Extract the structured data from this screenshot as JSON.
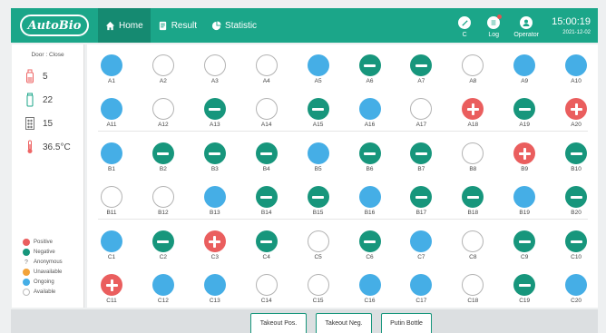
{
  "header": {
    "logo": "AutoBio",
    "nav": [
      {
        "label": "Home",
        "icon": "home-icon",
        "active": true
      },
      {
        "label": "Result",
        "icon": "result-icon",
        "active": false
      },
      {
        "label": "Statistic",
        "icon": "pie-chart-icon",
        "active": false
      }
    ],
    "status_icons": [
      {
        "label": "C",
        "icon": "compass-icon"
      },
      {
        "label": "Log",
        "icon": "log-icon"
      },
      {
        "label": "Operator",
        "icon": "user-icon"
      }
    ],
    "time": "15:00:19",
    "date": "2021-12-02"
  },
  "sidebar": {
    "door_status": "Door : Close",
    "stats": [
      {
        "icon": "bottle-icon",
        "value": "5"
      },
      {
        "icon": "tube-icon",
        "value": "22"
      },
      {
        "icon": "rack-icon",
        "value": "15"
      },
      {
        "icon": "thermometer-icon",
        "value": "36.5°C"
      }
    ],
    "legend": [
      {
        "label": "Positive",
        "state": "positive"
      },
      {
        "label": "Negative",
        "state": "negative"
      },
      {
        "label": "Anonymous",
        "state": "anonymous"
      },
      {
        "label": "Unavailable",
        "state": "unavailable"
      },
      {
        "label": "Ongoing",
        "state": "ongoing"
      },
      {
        "label": "Available",
        "state": "available"
      }
    ]
  },
  "grid": {
    "sections": [
      {
        "rows": [
          [
            [
              "A1",
              "ongoing"
            ],
            [
              "A2",
              "available"
            ],
            [
              "A3",
              "available"
            ],
            [
              "A4",
              "available"
            ],
            [
              "A5",
              "ongoing"
            ],
            [
              "A6",
              "negative"
            ],
            [
              "A7",
              "negative"
            ],
            [
              "A8",
              "available"
            ],
            [
              "A9",
              "ongoing"
            ],
            [
              "A10",
              "ongoing"
            ]
          ],
          [
            [
              "A11",
              "ongoing"
            ],
            [
              "A12",
              "available"
            ],
            [
              "A13",
              "negative"
            ],
            [
              "A14",
              "available"
            ],
            [
              "A15",
              "negative"
            ],
            [
              "A16",
              "ongoing"
            ],
            [
              "A17",
              "available"
            ],
            [
              "A18",
              "positive"
            ],
            [
              "A19",
              "negative"
            ],
            [
              "A20",
              "positive"
            ]
          ]
        ]
      },
      {
        "rows": [
          [
            [
              "B1",
              "ongoing"
            ],
            [
              "B2",
              "negative"
            ],
            [
              "B3",
              "negative"
            ],
            [
              "B4",
              "negative"
            ],
            [
              "B5",
              "ongoing"
            ],
            [
              "B6",
              "negative"
            ],
            [
              "B7",
              "negative"
            ],
            [
              "B8",
              "available"
            ],
            [
              "B9",
              "positive"
            ],
            [
              "B10",
              "negative"
            ]
          ],
          [
            [
              "B11",
              "available"
            ],
            [
              "B12",
              "available"
            ],
            [
              "B13",
              "ongoing"
            ],
            [
              "B14",
              "negative"
            ],
            [
              "B15",
              "negative"
            ],
            [
              "B16",
              "ongoing"
            ],
            [
              "B17",
              "negative"
            ],
            [
              "B18",
              "negative"
            ],
            [
              "B19",
              "ongoing"
            ],
            [
              "B20",
              "negative"
            ]
          ]
        ]
      },
      {
        "rows": [
          [
            [
              "C1",
              "ongoing"
            ],
            [
              "C2",
              "negative"
            ],
            [
              "C3",
              "positive"
            ],
            [
              "C4",
              "negative"
            ],
            [
              "C5",
              "available"
            ],
            [
              "C6",
              "negative"
            ],
            [
              "C7",
              "ongoing"
            ],
            [
              "C8",
              "available"
            ],
            [
              "C9",
              "negative"
            ],
            [
              "C10",
              "negative"
            ]
          ],
          [
            [
              "C11",
              "positive"
            ],
            [
              "C12",
              "ongoing"
            ],
            [
              "C13",
              "ongoing"
            ],
            [
              "C14",
              "available"
            ],
            [
              "C15",
              "available"
            ],
            [
              "C16",
              "ongoing"
            ],
            [
              "C17",
              "ongoing"
            ],
            [
              "C18",
              "available"
            ],
            [
              "C19",
              "negative"
            ],
            [
              "C20",
              "ongoing"
            ]
          ]
        ]
      }
    ]
  },
  "actions": [
    {
      "label": "Takeout Pos."
    },
    {
      "label": "Takeout Neg."
    },
    {
      "label": "Putin Bottle"
    }
  ],
  "colors": {
    "primary": "#1ba689",
    "positive": "#ea5e5e",
    "negative": "#17967c",
    "ongoing": "#45aee6",
    "unavailable": "#f2a33a",
    "available": "#ffffff"
  }
}
